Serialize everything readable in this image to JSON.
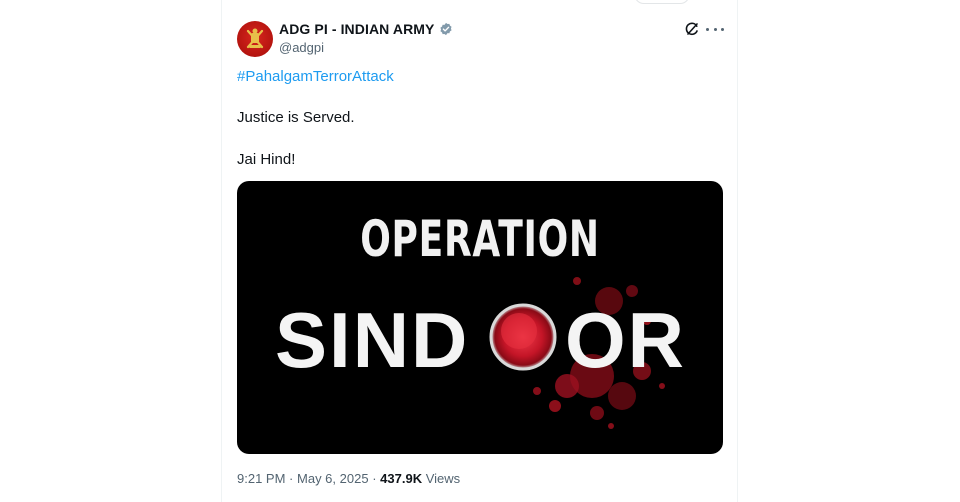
{
  "author": {
    "display_name": "ADG PI - INDIAN ARMY",
    "handle": "@adgpi",
    "verified_color": "#829aab"
  },
  "tweet": {
    "hashtag": "#PahalgamTerrorAttack",
    "line1": "Justice is Served.",
    "line2": "Jai Hind!"
  },
  "media": {
    "title_top": "OPERATION",
    "title_left": "SIND",
    "title_right": "OR"
  },
  "meta": {
    "time": "9:21 PM",
    "separator": "·",
    "date": "May 6, 2025",
    "views_count": "437.9K",
    "views_label": "Views"
  },
  "icons": {
    "grok": "grok-icon",
    "more": "more-options-icon",
    "verified": "verified-badge-icon"
  },
  "colors": {
    "link": "#1d9bf0",
    "secondary_text": "#536471",
    "sindoor_red": "#c8102e"
  }
}
